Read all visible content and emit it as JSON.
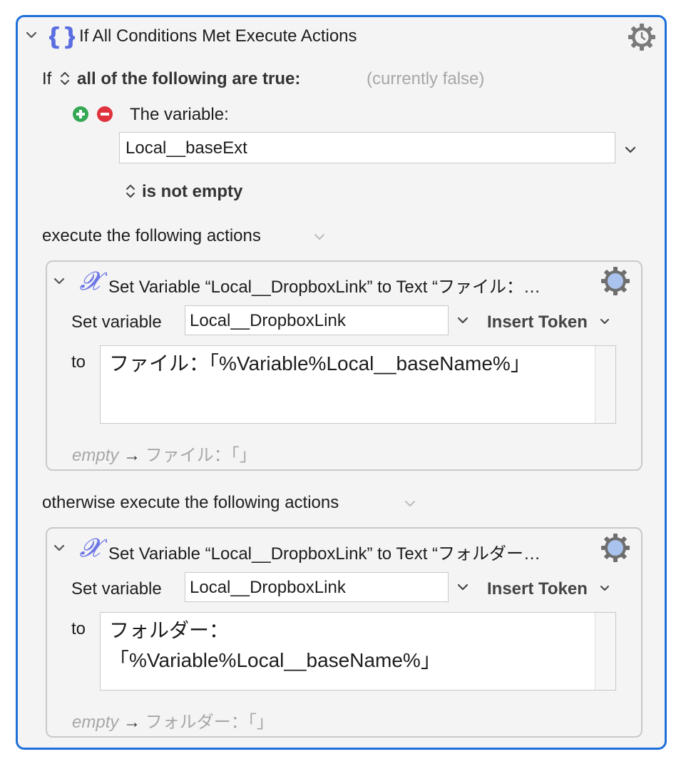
{
  "header": {
    "title": "If All Conditions Met Execute Actions"
  },
  "condition": {
    "if_label": "If",
    "mode": "all of the following are true:",
    "status": "(currently false)",
    "type_label": "The variable:",
    "variable_value": "Local__baseExt",
    "test": "is not empty"
  },
  "then_section": {
    "label": "execute the following actions"
  },
  "else_section": {
    "label": "otherwise execute the following actions"
  },
  "action1": {
    "title": "Set Variable “Local__DropboxLink” to Text “ファイル：…",
    "set_variable_label": "Set variable",
    "variable_value": "Local__DropboxLink",
    "insert_token": "Insert Token",
    "to_label": "to",
    "text_value": "ファイル：「%Variable%Local__baseName%」",
    "preview_empty": "empty",
    "preview_arrow": "→",
    "preview_value": "ファイル：「」"
  },
  "action2": {
    "title": "Set Variable “Local__DropboxLink” to Text “フォルダー…",
    "set_variable_label": "Set variable",
    "variable_value": "Local__DropboxLink",
    "insert_token": "Insert Token",
    "to_label": "to",
    "text_value": "フォルダー：\n「%Variable%Local__baseName%」",
    "preview_empty": "empty",
    "preview_arrow": "→",
    "preview_value": "フォルダー：「」"
  },
  "colors": {
    "accent": "#1e6fd9",
    "add_button": "#34a853",
    "remove_button": "#e0323c",
    "muted_text": "#a7a7a7",
    "action_icon": "#6d78e6"
  }
}
